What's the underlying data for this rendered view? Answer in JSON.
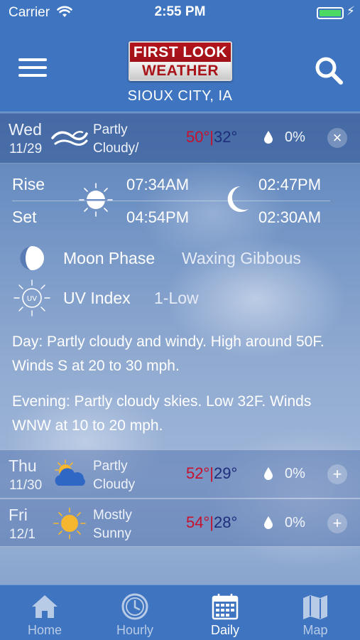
{
  "status_bar": {
    "carrier": "Carrier",
    "time": "2:55 PM",
    "battery_level": 1.0
  },
  "header": {
    "logo_line1": "FIRST LOOK",
    "logo_line2": "WEATHER",
    "location": "SIOUX CITY, IA",
    "menu_icon": "hamburger-menu-icon",
    "search_icon": "search-icon"
  },
  "colors": {
    "header_blue": "#3f75c0",
    "high_temp": "#c8102e",
    "low_temp": "#1f2d7a",
    "battery_green": "#4cd964"
  },
  "days": [
    {
      "name": "Wed",
      "date": "11/29",
      "condition_line1": "Partly",
      "condition_line2": "Cloudy/",
      "icon": "wind-icon",
      "high": "50°",
      "separator": "|",
      "low": "32°",
      "precip": "0%",
      "toggle": "×"
    },
    {
      "name": "Thu",
      "date": "11/30",
      "condition_line1": "Partly",
      "condition_line2": "Cloudy",
      "icon": "partly-cloudy-icon",
      "high": "52°",
      "separator": "|",
      "low": "29°",
      "precip": "0%",
      "toggle": "+"
    },
    {
      "name": "Fri",
      "date": "12/1",
      "condition_line1": "Mostly",
      "condition_line2": "Sunny",
      "icon": "sun-icon",
      "high": "54°",
      "separator": "|",
      "low": "28°",
      "precip": "0%",
      "toggle": "+"
    }
  ],
  "detail": {
    "rise_label": "Rise",
    "set_label": "Set",
    "sunrise": "07:34AM",
    "sunset": "04:54PM",
    "moonrise": "02:47PM",
    "moonset": "02:30AM",
    "moon_phase_label": "Moon Phase",
    "moon_phase_value": "Waxing Gibbous",
    "uv_label": "UV Index",
    "uv_value": "1-Low",
    "uv_badge": "UV",
    "day_text": "Day: Partly cloudy and windy. High around 50F. Winds S at 20 to 30 mph.",
    "evening_text": "Evening: Partly cloudy skies. Low 32F. Winds WNW at 10 to 20 mph."
  },
  "tabs": [
    {
      "label": "Home",
      "icon": "home-icon",
      "active": false
    },
    {
      "label": "Hourly",
      "icon": "clock-icon",
      "active": false
    },
    {
      "label": "Daily",
      "icon": "calendar-icon",
      "active": true
    },
    {
      "label": "Map",
      "icon": "map-icon",
      "active": false
    }
  ]
}
